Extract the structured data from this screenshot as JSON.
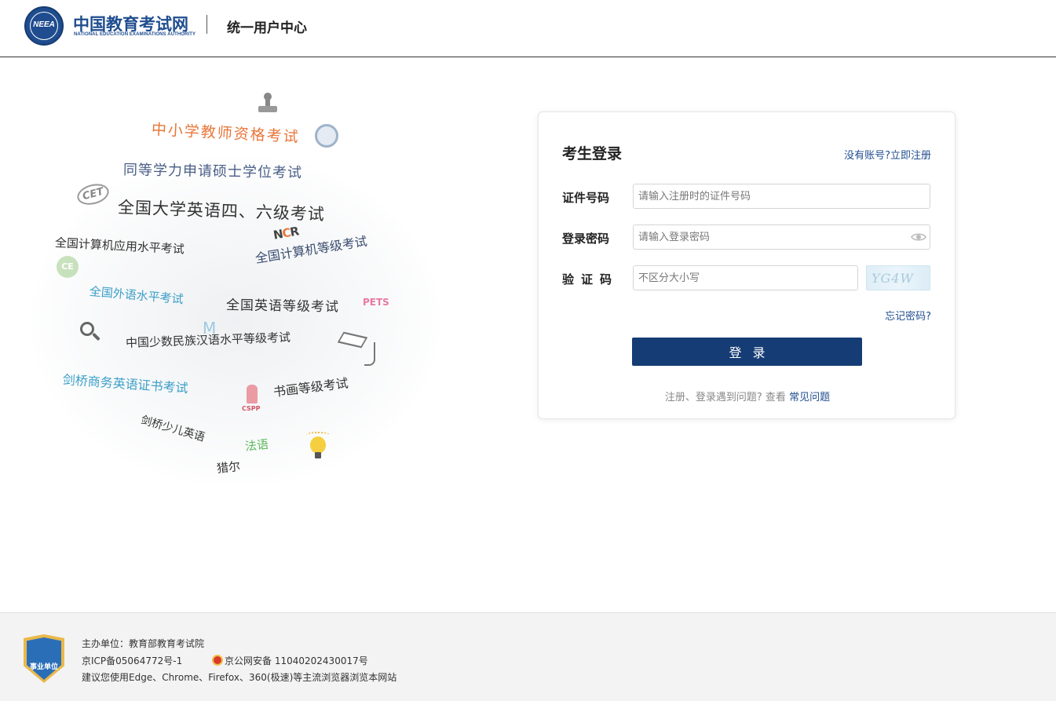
{
  "header": {
    "logo_title": "中国教育考试网",
    "logo_subtitle": "NATIONAL EDUCATION EXAMINATIONS AUTHORITY",
    "logo_emblem_text": "NEEA",
    "page_subtitle": "统一用户中心"
  },
  "illustration": {
    "words": [
      "中小学教师资格考试",
      "同等学力申请硕士学位考试",
      "全国大学英语四、六级考试",
      "全国计算机应用水平考试",
      "全国计算机等级考试",
      "全国外语水平考试",
      "全国英语等级考试",
      "中国少数民族汉语水平等级考试",
      "剑桥商务英语证书考试",
      "书画等级考试",
      "剑桥少儿英语",
      "法语",
      "猎尔"
    ],
    "badges": {
      "cet": "CET",
      "ncr_prefix": "N",
      "ncr_accent": "C",
      "ncr_suffix": "R",
      "ce": "CE",
      "pets": "PETS",
      "mhk": "M",
      "cspp": "CSPP"
    }
  },
  "login": {
    "title": "考生登录",
    "register_link": "没有账号?立即注册",
    "id_label": "证件号码",
    "id_placeholder": "请输入注册时的证件号码",
    "password_label": "登录密码",
    "password_placeholder": "请输入登录密码",
    "code_label": "验证码",
    "code_placeholder": "不区分大小写",
    "captcha_text": "YG4W",
    "forgot_link": "忘记密码?",
    "login_button": "登录",
    "help_prefix": "注册、登录遇到问题? 查看",
    "help_link": "常见问题"
  },
  "footer": {
    "badge_text": "事业单位",
    "host": "主办单位：教育部教育考试院",
    "icp": "京ICP备05064772号-1",
    "police_record": "京公网安备 11040202430017号",
    "browser_tip": "建议您使用Edge、Chrome、Firefox、360(极速)等主流浏览器浏览本网站"
  },
  "colors": {
    "brand_blue": "#1f4d8f",
    "button_blue": "#153c74",
    "accent_orange": "#e8763a",
    "footer_bg": "#f3f3f3"
  }
}
